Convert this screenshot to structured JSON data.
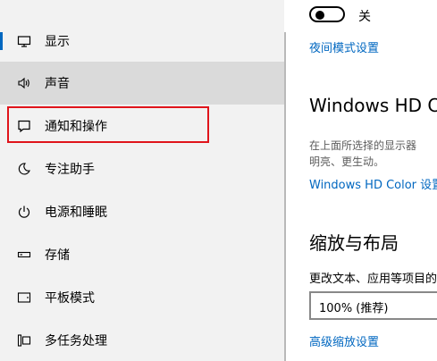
{
  "sidebar": {
    "items": [
      {
        "label": "显示",
        "icon": "monitor-icon"
      },
      {
        "label": "声音",
        "icon": "speaker-icon"
      },
      {
        "label": "通知和操作",
        "icon": "notification-icon"
      },
      {
        "label": "专注助手",
        "icon": "moon-icon"
      },
      {
        "label": "电源和睡眠",
        "icon": "power-icon"
      },
      {
        "label": "存储",
        "icon": "storage-icon"
      },
      {
        "label": "平板模式",
        "icon": "tablet-icon"
      },
      {
        "label": "多任务处理",
        "icon": "multitasking-icon"
      }
    ],
    "accent_color": "#0067c0",
    "highlight_color": "#e0141b"
  },
  "content": {
    "night_light": {
      "toggle_state": "关",
      "settings_link": "夜间模式设置"
    },
    "hd_color": {
      "heading": "Windows HD Co",
      "description_line1": "在上面所选择的显示器",
      "description_line2": "明亮、更生动。",
      "settings_link": "Windows HD Color 设置"
    },
    "scale_layout": {
      "heading": "缩放与布局",
      "field_label": "更改文本、应用等项目的",
      "dropdown_value": "100% (推荐)",
      "advanced_link": "高级缩放设置"
    }
  }
}
